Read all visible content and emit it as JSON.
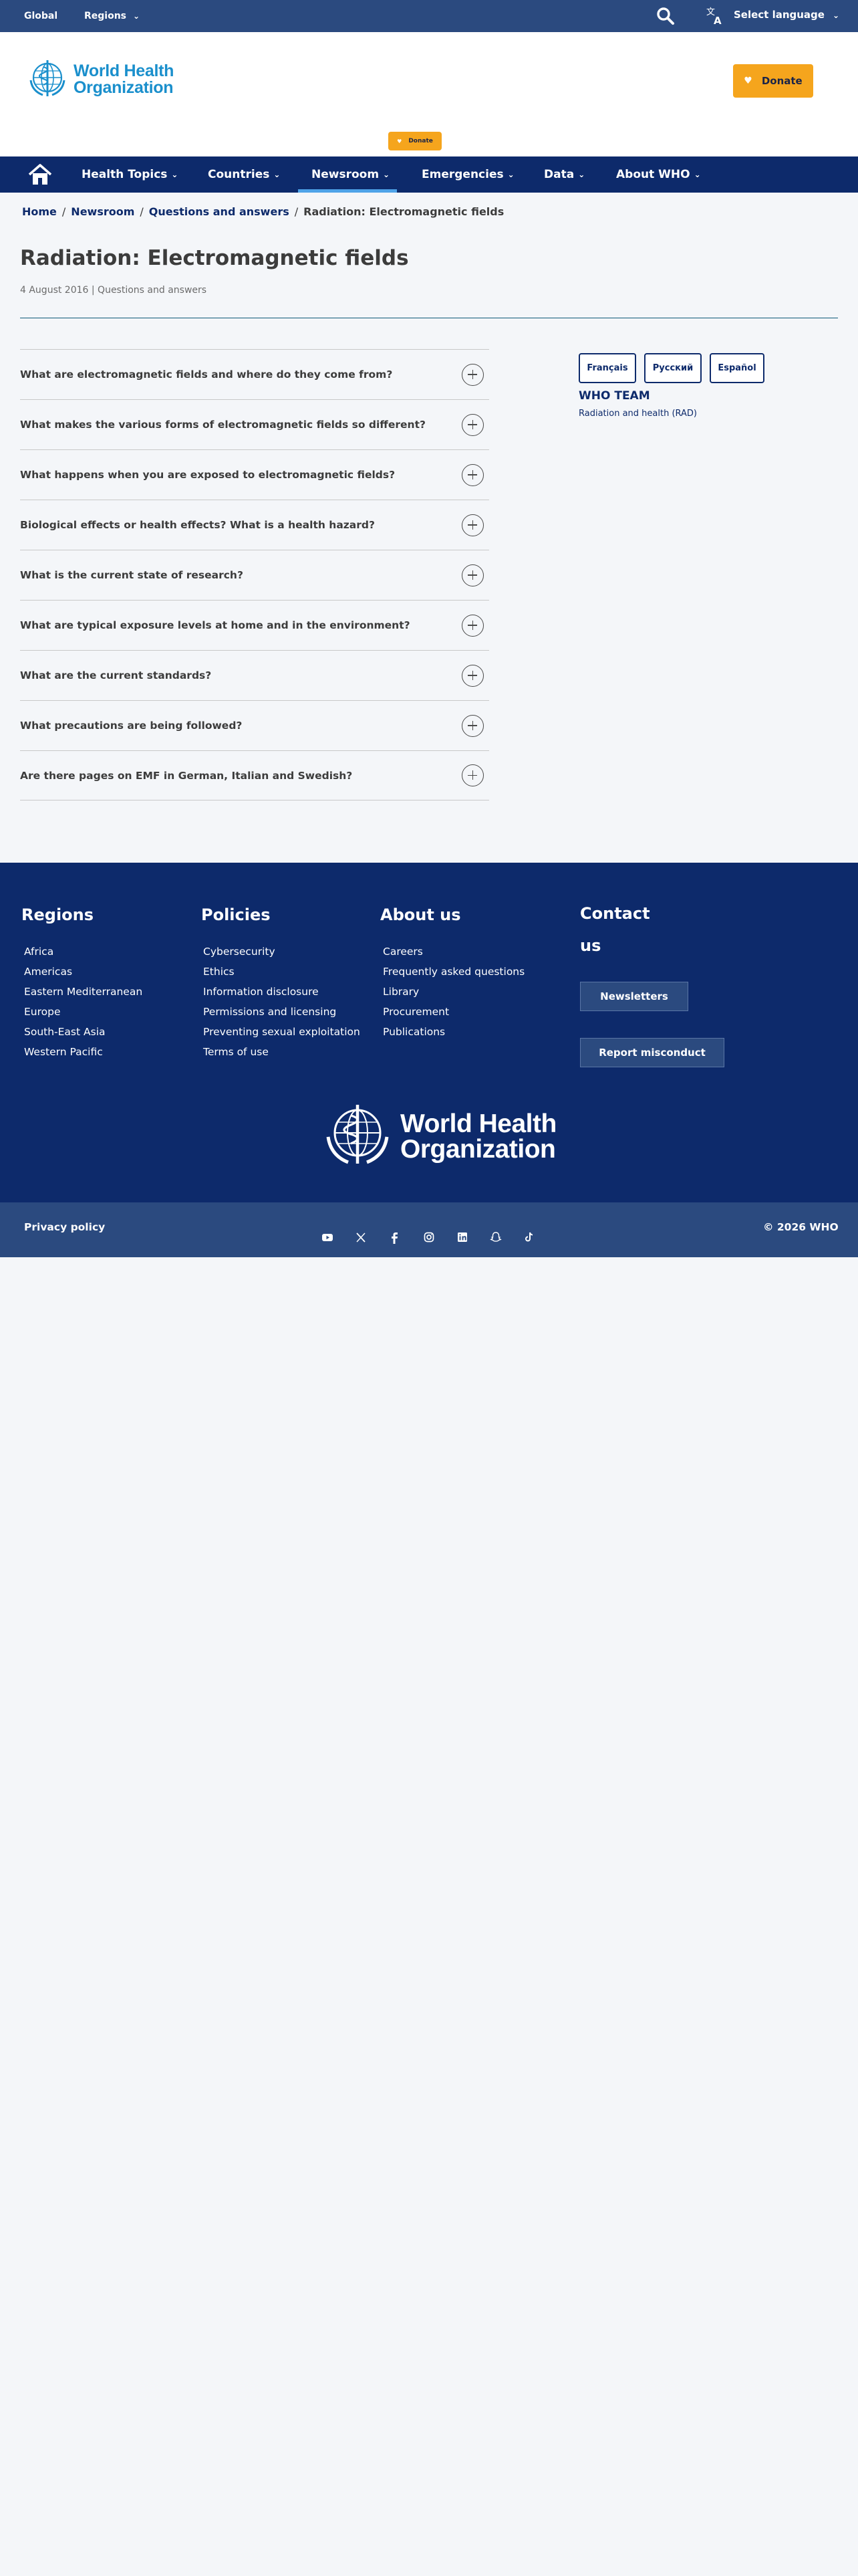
{
  "topbar": {
    "global": "Global",
    "regions": "Regions",
    "select_language": "Select language"
  },
  "header": {
    "logo_line1": "World Health",
    "logo_line2": "Organization",
    "donate": "Donate",
    "donate_small": "Donate"
  },
  "nav": {
    "items": [
      {
        "label": "Health Topics"
      },
      {
        "label": "Countries"
      },
      {
        "label": "Newsroom"
      },
      {
        "label": "Emergencies"
      },
      {
        "label": "Data"
      },
      {
        "label": "About WHO"
      }
    ]
  },
  "breadcrumb": {
    "items": [
      "Home",
      "Newsroom",
      "Questions and answers"
    ],
    "current": "Radiation: Electromagnetic fields"
  },
  "page": {
    "title": "Radiation: Electromagnetic fields",
    "meta": "4 August 2016 | Questions and answers"
  },
  "accordion": {
    "items": [
      "What are electromagnetic fields and where do they come from?",
      "What makes the various forms of electromagnetic fields so different?",
      "What happens when you are exposed to electromagnetic fields?",
      "Biological effects or health effects? What is a health hazard?",
      "What is the current state of research?",
      "What are typical exposure levels at home and in the environment?",
      "What are the current standards?",
      "What precautions are being followed?",
      "Are there pages on EMF in German, Italian and Swedish?"
    ]
  },
  "sidebar": {
    "languages": [
      "Français",
      "Русский",
      "Español"
    ],
    "team_heading": "WHO TEAM",
    "team_link": "Radiation and health (RAD)"
  },
  "footer": {
    "regions": {
      "title": "Regions",
      "items": [
        "Africa",
        "Americas",
        "Eastern Mediterranean",
        "Europe",
        "South-East Asia",
        "Western Pacific"
      ]
    },
    "policies": {
      "title": "Policies",
      "items": [
        "Cybersecurity",
        "Ethics",
        "Information disclosure",
        "Permissions and licensing",
        "Preventing sexual exploitation",
        "Terms of use"
      ]
    },
    "about": {
      "title": "About us",
      "items": [
        "Careers",
        "Frequently asked questions",
        "Library",
        "Procurement",
        "Publications"
      ]
    },
    "contact": {
      "title_line1": "Contact",
      "title_line2": "us",
      "newsletters": "Newsletters",
      "report": "Report misconduct"
    },
    "logo_line1": "World Health",
    "logo_line2": "Organization"
  },
  "bottombar": {
    "privacy": "Privacy policy",
    "copyright": "© 2026   WHO",
    "social_icons": [
      "youtube-icon",
      "x-icon",
      "facebook-icon",
      "instagram-icon",
      "linkedin-icon",
      "snapchat-icon",
      "tiktok-icon"
    ]
  },
  "colors": {
    "topbar": "#2b4a7f",
    "nav": "#0d2a6b",
    "donate": "#f5a51d",
    "logo_blue": "#1a8fcc",
    "nav_active": "#4fa3e8"
  }
}
